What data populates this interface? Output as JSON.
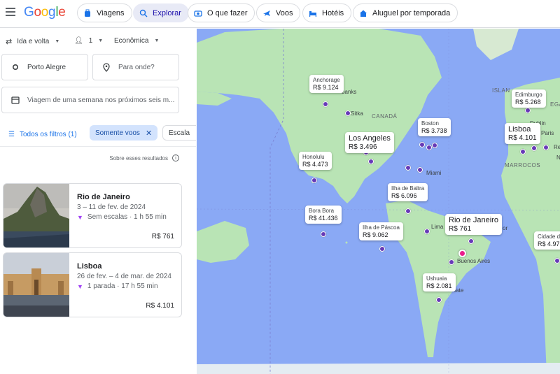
{
  "header": {
    "logo": "Google",
    "nav": [
      {
        "label": "Viagens",
        "icon": "suitcase-icon"
      },
      {
        "label": "Explorar",
        "icon": "explore-icon",
        "active": true
      },
      {
        "label": "O que fazer",
        "icon": "camera-icon"
      },
      {
        "label": "Voos",
        "icon": "plane-icon"
      },
      {
        "label": "Hotéis",
        "icon": "bed-icon"
      },
      {
        "label": "Aluguel por temporada",
        "icon": "house-icon"
      }
    ]
  },
  "search": {
    "trip_type": "Ida e volta",
    "passengers": "1",
    "cabin_class": "Econômica",
    "origin": "Porto Alegre",
    "destination_placeholder": "Para onde?",
    "dates_placeholder": "Viagem de uma semana nos próximos seis m..."
  },
  "filters": {
    "all_label": "Todos os filtros (1)",
    "active_filter": "Somente voos",
    "next_filter": "Escala"
  },
  "about_results": "Sobre esses resultados",
  "results": [
    {
      "city": "Rio de Janeiro",
      "dates": "3 – 11 de fev. de 2024",
      "stops": "Sem escalas · 1 h 55 min",
      "price": "R$ 761"
    },
    {
      "city": "Lisboa",
      "dates": "26 de fev. – 4 de mar. de 2024",
      "stops": "1 parada · 17 h 55 min",
      "price": "R$ 4.101"
    }
  ],
  "map": {
    "regions": [
      {
        "name": "CANADÁ"
      },
      {
        "name": "MARROCOS"
      },
      {
        "name": "ISLAN"
      },
      {
        "name": "EGA"
      }
    ],
    "small_labels": [
      "banks",
      "Sitka",
      "Miami",
      "Lima",
      "Buenos Aires",
      "fate",
      "Dublin",
      "Paris",
      "Re",
      "N",
      "or"
    ],
    "bubbles": [
      {
        "city": "Anchorage",
        "price": "R$ 9.124"
      },
      {
        "city": "Boston",
        "price": "R$ 3.738"
      },
      {
        "city": "Los Angeles",
        "price": "R$ 3.496"
      },
      {
        "city": "Honolulu",
        "price": "R$ 4.473"
      },
      {
        "city": "Ilha de Baltra",
        "price": "R$ 6.096"
      },
      {
        "city": "Bora Bora",
        "price": "R$ 41.436"
      },
      {
        "city": "Ilha de Páscoa",
        "price": "R$ 9.062"
      },
      {
        "city": "Rio de Janeiro",
        "price": "R$ 761"
      },
      {
        "city": "Ushuaia",
        "price": "R$ 2.081"
      },
      {
        "city": "Edimburgo",
        "price": "R$ 5.268"
      },
      {
        "city": "Lisboa",
        "price": "R$ 4.101"
      },
      {
        "city": "Cidade d",
        "price": "R$ 4.97"
      }
    ],
    "colors": {
      "ocean": "#8aa9f5",
      "land": "#b9e4b5",
      "pin": "#673ab7",
      "origin": "#e91e8c"
    }
  }
}
